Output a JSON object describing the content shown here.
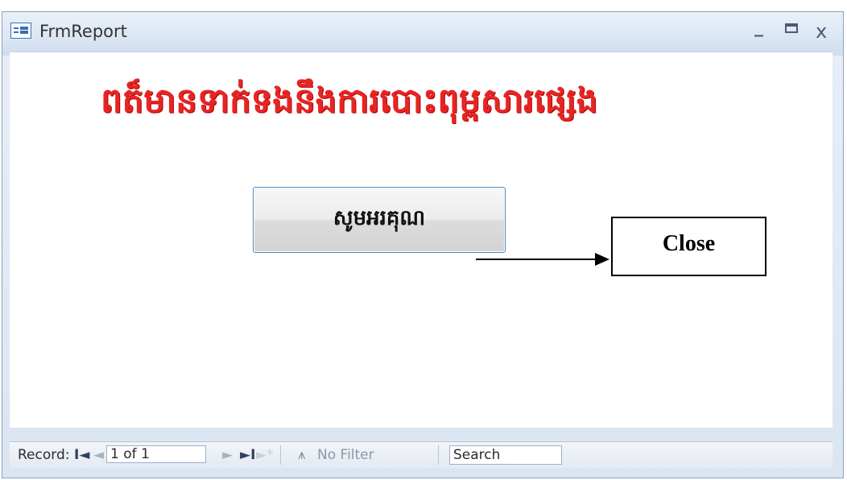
{
  "window": {
    "title": "FrmReport",
    "controls": {
      "minimize": "_",
      "maximize": "□",
      "close": "x"
    }
  },
  "form": {
    "heading": "ពត៏មានទាក់ទងនឹងការបោះពុម្ពសារផ្សេង",
    "thanks_button": "សូមអរគុណ"
  },
  "annotation": {
    "callout": "Close"
  },
  "record_nav": {
    "label": "Record:",
    "first": "I◄",
    "prev": "◄",
    "current": "1 of 1",
    "next": "►",
    "last": "►I",
    "new": "►*",
    "filter_icon": "funnel-icon",
    "filter_label": "No Filter",
    "search_placeholder": "Search"
  },
  "colors": {
    "heading": "#e82424",
    "button_border": "#4a8bc9"
  }
}
